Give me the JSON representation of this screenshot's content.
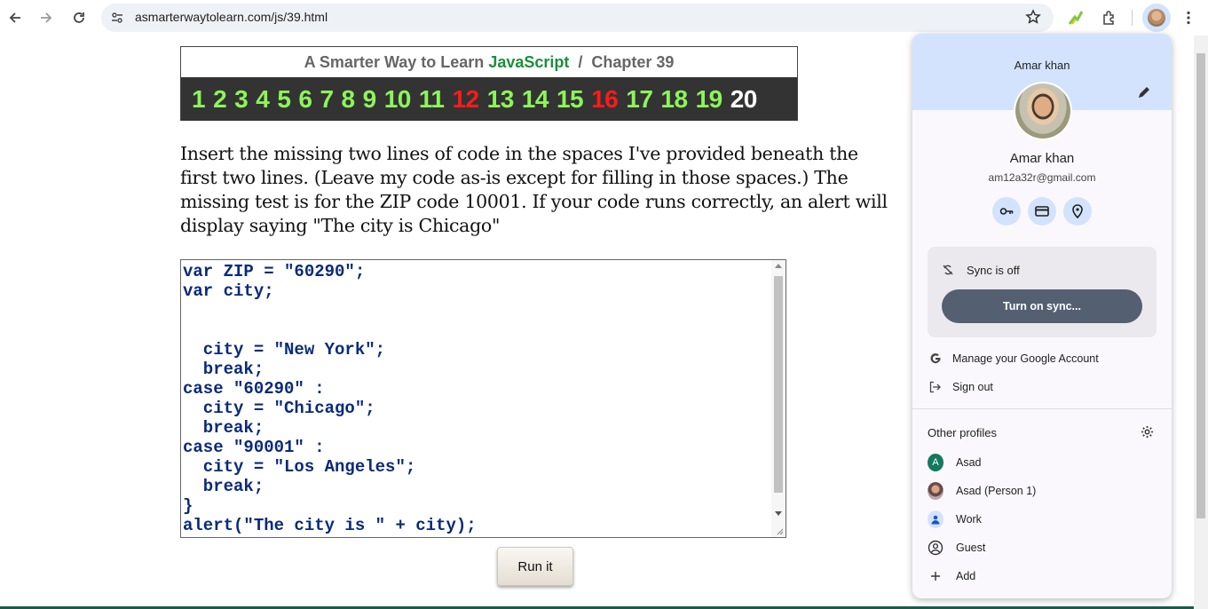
{
  "browser": {
    "url": "asmarterwaytolearn.com/js/39.html"
  },
  "page": {
    "title_prefix": "A Smarter Way to Learn ",
    "title_js": "JavaScript",
    "title_suffix": "  /  Chapter 39",
    "chapters": [
      {
        "n": "1",
        "state": "done"
      },
      {
        "n": "2",
        "state": "done"
      },
      {
        "n": "3",
        "state": "done"
      },
      {
        "n": "4",
        "state": "done"
      },
      {
        "n": "5",
        "state": "done"
      },
      {
        "n": "6",
        "state": "done"
      },
      {
        "n": "7",
        "state": "done"
      },
      {
        "n": "8",
        "state": "done"
      },
      {
        "n": "9",
        "state": "done"
      },
      {
        "n": "10",
        "state": "done"
      },
      {
        "n": "11",
        "state": "done"
      },
      {
        "n": "12",
        "state": "wrong"
      },
      {
        "n": "13",
        "state": "done"
      },
      {
        "n": "14",
        "state": "done"
      },
      {
        "n": "15",
        "state": "done"
      },
      {
        "n": "16",
        "state": "wrong"
      },
      {
        "n": "17",
        "state": "done"
      },
      {
        "n": "18",
        "state": "done"
      },
      {
        "n": "19",
        "state": "done"
      },
      {
        "n": "20",
        "state": "current"
      }
    ],
    "instructions": "Insert the missing two lines of code in the spaces I've provided beneath the first two lines. (Leave my code as-is except for filling in those spaces.) The missing test is for the ZIP code 10001. If your code runs correctly, an alert will display saying \"The city is Chicago\"",
    "code": [
      "var ZIP = \"60290\";",
      "var city;",
      "",
      "",
      "  city = \"New York\";",
      "  break;",
      "case \"60290\" :",
      "  city = \"Chicago\";",
      "  break;",
      "case \"90001\" :",
      "  city = \"Los Angeles\";",
      "  break;",
      "}",
      "alert(\"The city is \" + city);"
    ],
    "run_label": "Run it"
  },
  "profile_menu": {
    "header_name": "Amar khan",
    "name": "Amar khan",
    "email": "am12a32r@gmail.com",
    "sync_status": "Sync is off",
    "sync_button": "Turn on sync...",
    "manage_account": "Manage your Google Account",
    "sign_out": "Sign out",
    "other_profiles_title": "Other profiles",
    "profiles": [
      {
        "name": "Asad",
        "avatar": "letter-A"
      },
      {
        "name": "Asad (Person 1)",
        "avatar": "photo"
      },
      {
        "name": "Work",
        "avatar": "person"
      },
      {
        "name": "Guest",
        "avatar": "guest"
      },
      {
        "name": "Add",
        "avatar": "plus"
      }
    ]
  },
  "colors": {
    "chapter_done": "#8cf55a",
    "chapter_wrong": "#ff1a1a",
    "chapter_current": "#ffffff",
    "javascript_green": "#1a8f3a",
    "code_blue": "#0a2a7a",
    "menu_header": "#d3e3fd",
    "sync_button": "#555f72"
  }
}
